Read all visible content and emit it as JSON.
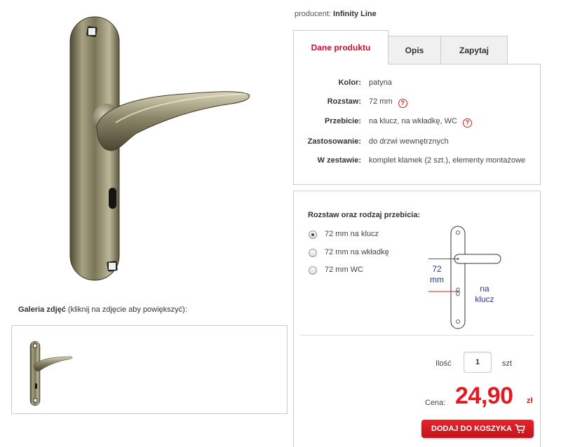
{
  "producer": {
    "label": "producent:",
    "name": "Infinity Line"
  },
  "tabs": [
    {
      "label": "Dane produktu",
      "active": true
    },
    {
      "label": "Opis",
      "active": false
    },
    {
      "label": "Zapytaj",
      "active": false
    }
  ],
  "details": [
    {
      "label": "Kolor:",
      "value": "patyna",
      "help": false
    },
    {
      "label": "Rozstaw:",
      "value": "72 mm",
      "help": true
    },
    {
      "label": "Przebicie:",
      "value": "na klucz, na wkładkę, WC",
      "help": true
    },
    {
      "label": "Zastosowanie:",
      "value": "do drzwi wewnętrznych",
      "help": false
    },
    {
      "label": "W zestawie:",
      "value": "komplet klamek (2 szt.), elementy montażowe",
      "help": false
    }
  ],
  "help_glyph": "?",
  "gallery": {
    "title_bold": "Galeria zdjęć",
    "title_rest": " (kliknij na zdjęcie aby powiększyć):"
  },
  "config": {
    "title": "Rozstaw oraz rodzaj przebicia:",
    "options": [
      {
        "label": "72 mm na klucz",
        "checked": true
      },
      {
        "label": "72 mm na wkładkę",
        "checked": false
      },
      {
        "label": "72 mm WC",
        "checked": false
      }
    ],
    "diagram": {
      "spacing_label_1": "72",
      "spacing_label_2": "mm",
      "type_label_1": "na",
      "type_label_2": "klucz"
    }
  },
  "quantity": {
    "label": "Ilość",
    "value": "1",
    "unit": "szt"
  },
  "price": {
    "label": "Cena:",
    "value": "24,90",
    "currency": "zł"
  },
  "cart_button": {
    "label": "DODAJ DO KOSZYKA"
  },
  "colors": {
    "accent": "#e11b22",
    "tab_active_text": "#c8102e",
    "diagram_blue": "#1f3a93"
  }
}
